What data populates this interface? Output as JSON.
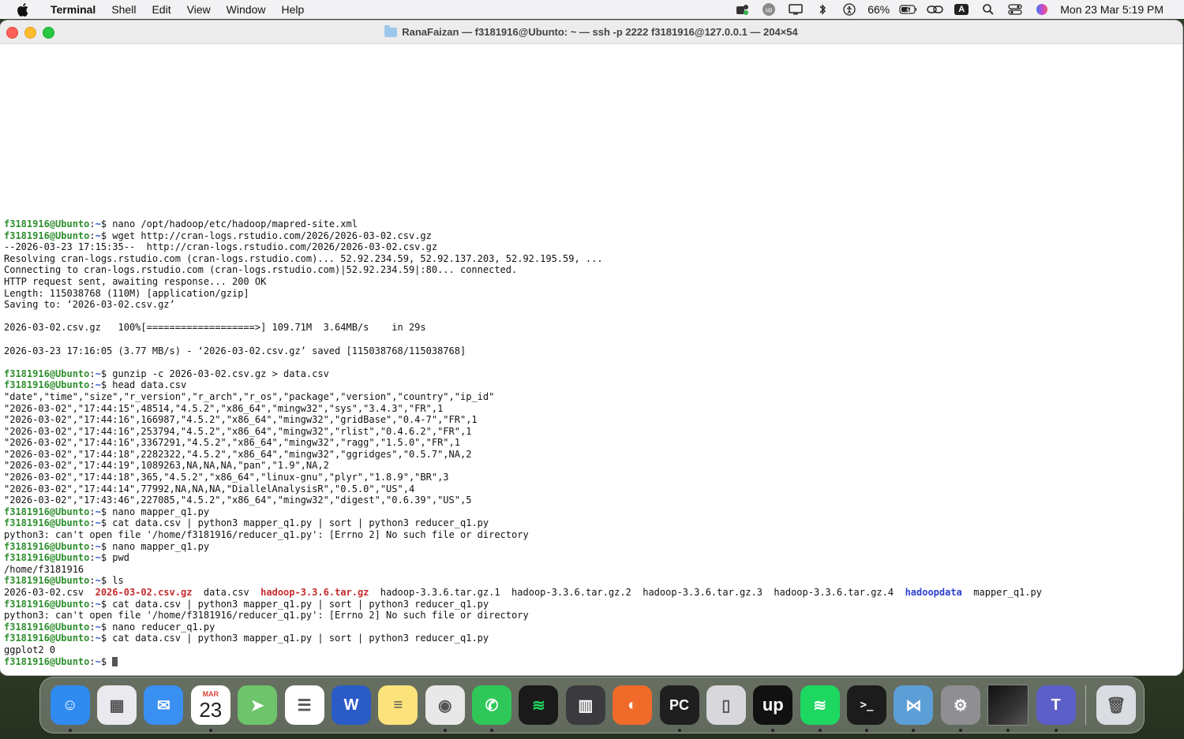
{
  "menubar": {
    "app_name": "Terminal",
    "items": [
      "Shell",
      "Edit",
      "View",
      "Window",
      "Help"
    ],
    "battery": "66%",
    "clock": "Mon 23 Mar  5:19 PM",
    "input_indicator": "A"
  },
  "window": {
    "title": "RanaFaizan — f3181916@Ubunto: ~ — ssh -p 2222 f3181916@127.0.0.1 — 204×54"
  },
  "prompt": {
    "user": "f3181916@Ubunto",
    "path": "~",
    "symbol": "$"
  },
  "terminal_lines": [
    {
      "kind": "cmd",
      "text": "nano /opt/hadoop/etc/hadoop/mapred-site.xml"
    },
    {
      "kind": "cmd",
      "text": "wget http://cran-logs.rstudio.com/2026/2026-03-02.csv.gz"
    },
    {
      "kind": "out",
      "text": "--2026-03-23 17:15:35--  http://cran-logs.rstudio.com/2026/2026-03-02.csv.gz"
    },
    {
      "kind": "out",
      "text": "Resolving cran-logs.rstudio.com (cran-logs.rstudio.com)... 52.92.234.59, 52.92.137.203, 52.92.195.59, ..."
    },
    {
      "kind": "out",
      "text": "Connecting to cran-logs.rstudio.com (cran-logs.rstudio.com)|52.92.234.59|:80... connected."
    },
    {
      "kind": "out",
      "text": "HTTP request sent, awaiting response... 200 OK"
    },
    {
      "kind": "out",
      "text": "Length: 115038768 (110M) [application/gzip]"
    },
    {
      "kind": "out",
      "text": "Saving to: ‘2026-03-02.csv.gz’"
    },
    {
      "kind": "out",
      "text": ""
    },
    {
      "kind": "out",
      "text": "2026-03-02.csv.gz   100%[===================>] 109.71M  3.64MB/s    in 29s"
    },
    {
      "kind": "out",
      "text": ""
    },
    {
      "kind": "out",
      "text": "2026-03-23 17:16:05 (3.77 MB/s) - ‘2026-03-02.csv.gz’ saved [115038768/115038768]"
    },
    {
      "kind": "out",
      "text": ""
    },
    {
      "kind": "cmd",
      "text": "gunzip -c 2026-03-02.csv.gz > data.csv"
    },
    {
      "kind": "cmd",
      "text": "head data.csv"
    },
    {
      "kind": "out",
      "text": "\"date\",\"time\",\"size\",\"r_version\",\"r_arch\",\"r_os\",\"package\",\"version\",\"country\",\"ip_id\""
    },
    {
      "kind": "out",
      "text": "\"2026-03-02\",\"17:44:15\",48514,\"4.5.2\",\"x86_64\",\"mingw32\",\"sys\",\"3.4.3\",\"FR\",1"
    },
    {
      "kind": "out",
      "text": "\"2026-03-02\",\"17:44:16\",166987,\"4.5.2\",\"x86_64\",\"mingw32\",\"gridBase\",\"0.4-7\",\"FR\",1"
    },
    {
      "kind": "out",
      "text": "\"2026-03-02\",\"17:44:16\",253794,\"4.5.2\",\"x86_64\",\"mingw32\",\"rlist\",\"0.4.6.2\",\"FR\",1"
    },
    {
      "kind": "out",
      "text": "\"2026-03-02\",\"17:44:16\",3367291,\"4.5.2\",\"x86_64\",\"mingw32\",\"ragg\",\"1.5.0\",\"FR\",1"
    },
    {
      "kind": "out",
      "text": "\"2026-03-02\",\"17:44:18\",2282322,\"4.5.2\",\"x86_64\",\"mingw32\",\"ggridges\",\"0.5.7\",NA,2"
    },
    {
      "kind": "out",
      "text": "\"2026-03-02\",\"17:44:19\",1089263,NA,NA,NA,\"pan\",\"1.9\",NA,2"
    },
    {
      "kind": "out",
      "text": "\"2026-03-02\",\"17:44:18\",365,\"4.5.2\",\"x86_64\",\"linux-gnu\",\"plyr\",\"1.8.9\",\"BR\",3"
    },
    {
      "kind": "out",
      "text": "\"2026-03-02\",\"17:44:14\",77992,NA,NA,NA,\"DiallelAnalysisR\",\"0.5.0\",\"US\",4"
    },
    {
      "kind": "out",
      "text": "\"2026-03-02\",\"17:43:46\",227085,\"4.5.2\",\"x86_64\",\"mingw32\",\"digest\",\"0.6.39\",\"US\",5"
    },
    {
      "kind": "cmd",
      "text": "nano mapper_q1.py"
    },
    {
      "kind": "cmd",
      "text": "cat data.csv | python3 mapper_q1.py | sort | python3 reducer_q1.py"
    },
    {
      "kind": "out",
      "text": "python3: can't open file '/home/f3181916/reducer_q1.py': [Errno 2] No such file or directory"
    },
    {
      "kind": "cmd",
      "text": "nano mapper_q1.py"
    },
    {
      "kind": "cmd",
      "text": "pwd"
    },
    {
      "kind": "out",
      "text": "/home/f3181916"
    },
    {
      "kind": "cmd",
      "text": "ls"
    },
    {
      "kind": "ls"
    },
    {
      "kind": "cmd",
      "text": "cat data.csv | python3 mapper_q1.py | sort | python3 reducer_q1.py"
    },
    {
      "kind": "out",
      "text": "python3: can't open file '/home/f3181916/reducer_q1.py': [Errno 2] No such file or directory"
    },
    {
      "kind": "cmd",
      "text": "nano reducer_q1.py"
    },
    {
      "kind": "cmd",
      "text": "cat data.csv | python3 mapper_q1.py | sort | python3 reducer_q1.py"
    },
    {
      "kind": "out",
      "text": "ggplot2 0"
    },
    {
      "kind": "prompt"
    }
  ],
  "ls_entries": [
    {
      "name": "2026-03-02.csv",
      "style": "plain"
    },
    {
      "name": "2026-03-02.csv.gz",
      "style": "red"
    },
    {
      "name": "data.csv",
      "style": "plain"
    },
    {
      "name": "hadoop-3.3.6.tar.gz",
      "style": "red"
    },
    {
      "name": "hadoop-3.3.6.tar.gz.1",
      "style": "plain"
    },
    {
      "name": "hadoop-3.3.6.tar.gz.2",
      "style": "plain"
    },
    {
      "name": "hadoop-3.3.6.tar.gz.3",
      "style": "plain"
    },
    {
      "name": "hadoop-3.3.6.tar.gz.4",
      "style": "plain"
    },
    {
      "name": "hadoopdata",
      "style": "blue"
    },
    {
      "name": "mapper_q1.py",
      "style": "plain"
    }
  ],
  "dock": {
    "calendar_month": "MAR",
    "calendar_day": "23",
    "apps": [
      {
        "name": "finder",
        "icon": "finder-icon",
        "color": "#2f8bf0",
        "glyph": "☺",
        "running": true
      },
      {
        "name": "launchpad",
        "icon": "launchpad-icon",
        "color": "#e9e9ee",
        "glyph": "▦",
        "running": false
      },
      {
        "name": "mail",
        "icon": "mail-icon",
        "color": "#3a8ff2",
        "glyph": "✉",
        "running": false
      },
      {
        "name": "calendar",
        "icon": "calendar-icon",
        "color": "#ffffff",
        "glyph": "",
        "running": true
      },
      {
        "name": "maps",
        "icon": "maps-icon",
        "color": "#6ec46a",
        "glyph": "➤",
        "running": false
      },
      {
        "name": "reminders",
        "icon": "reminders-icon",
        "color": "#ffffff",
        "glyph": "☰",
        "running": false
      },
      {
        "name": "word",
        "icon": "word-icon",
        "color": "#2a5bc6",
        "glyph": "W",
        "running": false
      },
      {
        "name": "notes",
        "icon": "notes-icon",
        "color": "#fbe27a",
        "glyph": "≡",
        "running": false
      },
      {
        "name": "chrome",
        "icon": "chrome-icon",
        "color": "#e8e8e8",
        "glyph": "◉",
        "running": true
      },
      {
        "name": "whatsapp",
        "icon": "whatsapp-icon",
        "color": "#2fc858",
        "glyph": "✆",
        "running": true
      },
      {
        "name": "spotify",
        "icon": "spotify-icon",
        "color": "#1a1a1a",
        "glyph": "≋",
        "running": false
      },
      {
        "name": "calculator",
        "icon": "calculator-icon",
        "color": "#3b3b3f",
        "glyph": "▥",
        "running": false
      },
      {
        "name": "firefox",
        "icon": "firefox-icon",
        "color": "#f06a2a",
        "glyph": "◐",
        "running": false
      },
      {
        "name": "pycharm",
        "icon": "pycharm-icon",
        "color": "#1f1f1f",
        "glyph": "PC",
        "running": true
      },
      {
        "name": "iphone-mirroring",
        "icon": "phone-icon",
        "color": "#d8d8dc",
        "glyph": "▯",
        "running": false
      },
      {
        "name": "upwork",
        "icon": "upwork-icon",
        "color": "#111111",
        "glyph": "up",
        "running": true
      },
      {
        "name": "spotify-2",
        "icon": "spotify-icon",
        "color": "#1ed760",
        "glyph": "≋",
        "running": true
      },
      {
        "name": "terminal",
        "icon": "terminal-icon",
        "color": "#1c1c1c",
        "glyph": ">_",
        "running": true
      },
      {
        "name": "vs",
        "icon": "visual-studio-icon",
        "color": "#5c9fd6",
        "glyph": "⋈",
        "running": true
      },
      {
        "name": "system-settings",
        "icon": "gear-icon",
        "color": "#8e8e93",
        "glyph": "⚙",
        "running": true
      },
      {
        "name": "screenshot-preview",
        "icon": "screenshot-icon",
        "color": "#222222",
        "glyph": "",
        "running": true
      },
      {
        "name": "teams",
        "icon": "teams-icon",
        "color": "#5b5fc7",
        "glyph": "T",
        "running": true
      },
      {
        "name": "trash",
        "icon": "trash-icon",
        "color": "#d9dde2",
        "glyph": "🗑",
        "running": false
      }
    ]
  }
}
